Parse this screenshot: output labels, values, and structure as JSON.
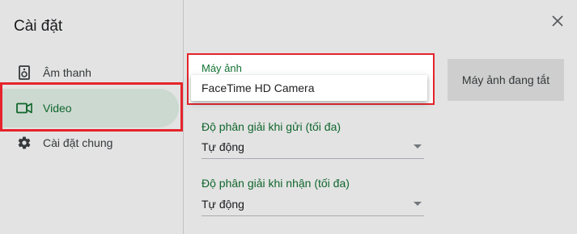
{
  "dialog": {
    "title": "Cài đặt",
    "close_icon": "close-icon"
  },
  "sidebar": {
    "items": [
      {
        "label": "Âm thanh",
        "icon": "speaker-icon",
        "active": false
      },
      {
        "label": "Video",
        "icon": "video-camera-icon",
        "active": true
      },
      {
        "label": "Cài đặt chung",
        "icon": "gear-icon",
        "active": false
      }
    ]
  },
  "video": {
    "camera": {
      "label": "Máy ảnh",
      "selected": "FaceTime HD Camera"
    },
    "preview": {
      "status": "Máy ảnh đang tắt"
    },
    "send_resolution": {
      "label": "Độ phân giải khi gửi (tối đa)",
      "value": "Tự động"
    },
    "receive_resolution": {
      "label": "Độ phân giải khi nhận (tối đa)",
      "value": "Tự động"
    }
  },
  "colors": {
    "accent_green": "#137333",
    "active_bg": "#e6f4ea",
    "highlight_red": "#e5242b"
  }
}
